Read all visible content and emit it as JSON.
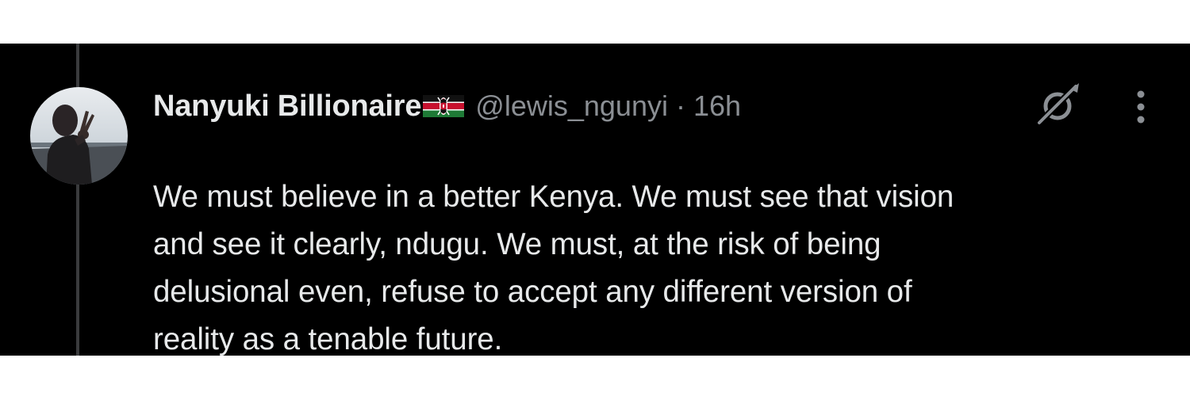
{
  "tweet": {
    "author_name": "Nanyuki Billionaire",
    "author_flag": "kenya-flag-emoji",
    "handle": "@lewis_ngunyi",
    "separator": "·",
    "time": "16h",
    "text_lines": [
      "We must believe in a better Kenya. We must see that vision",
      "and see it clearly, ndugu. We must, at the risk of being",
      "delusional even, refuse to accept any different version of",
      "reality as a tenable future."
    ]
  },
  "icons": {
    "grok": "grok-icon",
    "more": "more-options-icon",
    "avatar": "avatar"
  },
  "colors": {
    "background": "#000000",
    "text_primary": "#e7e9ea",
    "text_secondary": "#8b8f94",
    "thread_line": "#3a3b3d"
  }
}
